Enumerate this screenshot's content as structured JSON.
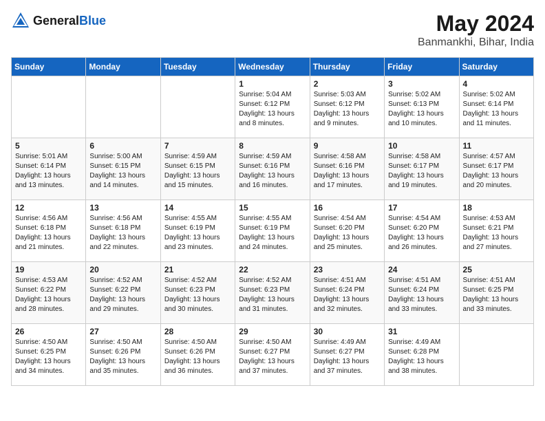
{
  "header": {
    "logo_general": "General",
    "logo_blue": "Blue",
    "month_year": "May 2024",
    "location": "Banmankhi, Bihar, India"
  },
  "weekdays": [
    "Sunday",
    "Monday",
    "Tuesday",
    "Wednesday",
    "Thursday",
    "Friday",
    "Saturday"
  ],
  "weeks": [
    [
      {
        "day": "",
        "sunrise": "",
        "sunset": "",
        "daylight": ""
      },
      {
        "day": "",
        "sunrise": "",
        "sunset": "",
        "daylight": ""
      },
      {
        "day": "",
        "sunrise": "",
        "sunset": "",
        "daylight": ""
      },
      {
        "day": "1",
        "sunrise": "5:04 AM",
        "sunset": "6:12 PM",
        "daylight": "13 hours and 8 minutes."
      },
      {
        "day": "2",
        "sunrise": "5:03 AM",
        "sunset": "6:12 PM",
        "daylight": "13 hours and 9 minutes."
      },
      {
        "day": "3",
        "sunrise": "5:02 AM",
        "sunset": "6:13 PM",
        "daylight": "13 hours and 10 minutes."
      },
      {
        "day": "4",
        "sunrise": "5:02 AM",
        "sunset": "6:14 PM",
        "daylight": "13 hours and 11 minutes."
      }
    ],
    [
      {
        "day": "5",
        "sunrise": "5:01 AM",
        "sunset": "6:14 PM",
        "daylight": "13 hours and 13 minutes."
      },
      {
        "day": "6",
        "sunrise": "5:00 AM",
        "sunset": "6:15 PM",
        "daylight": "13 hours and 14 minutes."
      },
      {
        "day": "7",
        "sunrise": "4:59 AM",
        "sunset": "6:15 PM",
        "daylight": "13 hours and 15 minutes."
      },
      {
        "day": "8",
        "sunrise": "4:59 AM",
        "sunset": "6:16 PM",
        "daylight": "13 hours and 16 minutes."
      },
      {
        "day": "9",
        "sunrise": "4:58 AM",
        "sunset": "6:16 PM",
        "daylight": "13 hours and 17 minutes."
      },
      {
        "day": "10",
        "sunrise": "4:58 AM",
        "sunset": "6:17 PM",
        "daylight": "13 hours and 19 minutes."
      },
      {
        "day": "11",
        "sunrise": "4:57 AM",
        "sunset": "6:17 PM",
        "daylight": "13 hours and 20 minutes."
      }
    ],
    [
      {
        "day": "12",
        "sunrise": "4:56 AM",
        "sunset": "6:18 PM",
        "daylight": "13 hours and 21 minutes."
      },
      {
        "day": "13",
        "sunrise": "4:56 AM",
        "sunset": "6:18 PM",
        "daylight": "13 hours and 22 minutes."
      },
      {
        "day": "14",
        "sunrise": "4:55 AM",
        "sunset": "6:19 PM",
        "daylight": "13 hours and 23 minutes."
      },
      {
        "day": "15",
        "sunrise": "4:55 AM",
        "sunset": "6:19 PM",
        "daylight": "13 hours and 24 minutes."
      },
      {
        "day": "16",
        "sunrise": "4:54 AM",
        "sunset": "6:20 PM",
        "daylight": "13 hours and 25 minutes."
      },
      {
        "day": "17",
        "sunrise": "4:54 AM",
        "sunset": "6:20 PM",
        "daylight": "13 hours and 26 minutes."
      },
      {
        "day": "18",
        "sunrise": "4:53 AM",
        "sunset": "6:21 PM",
        "daylight": "13 hours and 27 minutes."
      }
    ],
    [
      {
        "day": "19",
        "sunrise": "4:53 AM",
        "sunset": "6:22 PM",
        "daylight": "13 hours and 28 minutes."
      },
      {
        "day": "20",
        "sunrise": "4:52 AM",
        "sunset": "6:22 PM",
        "daylight": "13 hours and 29 minutes."
      },
      {
        "day": "21",
        "sunrise": "4:52 AM",
        "sunset": "6:23 PM",
        "daylight": "13 hours and 30 minutes."
      },
      {
        "day": "22",
        "sunrise": "4:52 AM",
        "sunset": "6:23 PM",
        "daylight": "13 hours and 31 minutes."
      },
      {
        "day": "23",
        "sunrise": "4:51 AM",
        "sunset": "6:24 PM",
        "daylight": "13 hours and 32 minutes."
      },
      {
        "day": "24",
        "sunrise": "4:51 AM",
        "sunset": "6:24 PM",
        "daylight": "13 hours and 33 minutes."
      },
      {
        "day": "25",
        "sunrise": "4:51 AM",
        "sunset": "6:25 PM",
        "daylight": "13 hours and 33 minutes."
      }
    ],
    [
      {
        "day": "26",
        "sunrise": "4:50 AM",
        "sunset": "6:25 PM",
        "daylight": "13 hours and 34 minutes."
      },
      {
        "day": "27",
        "sunrise": "4:50 AM",
        "sunset": "6:26 PM",
        "daylight": "13 hours and 35 minutes."
      },
      {
        "day": "28",
        "sunrise": "4:50 AM",
        "sunset": "6:26 PM",
        "daylight": "13 hours and 36 minutes."
      },
      {
        "day": "29",
        "sunrise": "4:50 AM",
        "sunset": "6:27 PM",
        "daylight": "13 hours and 37 minutes."
      },
      {
        "day": "30",
        "sunrise": "4:49 AM",
        "sunset": "6:27 PM",
        "daylight": "13 hours and 37 minutes."
      },
      {
        "day": "31",
        "sunrise": "4:49 AM",
        "sunset": "6:28 PM",
        "daylight": "13 hours and 38 minutes."
      },
      {
        "day": "",
        "sunrise": "",
        "sunset": "",
        "daylight": ""
      }
    ]
  ]
}
